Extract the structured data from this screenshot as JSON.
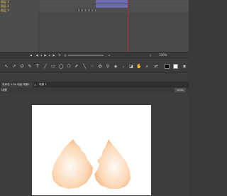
{
  "timeline": {
    "layers": [
      {
        "name": "图层 1",
        "color": "#e9c25a"
      },
      {
        "name": "图层 2",
        "color": "#e9c25a"
      },
      {
        "name": "图层 3",
        "color": "#e9c25a"
      }
    ]
  },
  "transport": {
    "zoom": "100%"
  },
  "tabs": {
    "document_tab": "未命名-1.fla 动画 场景1",
    "second_tab": "场景 1",
    "close_glyph": "×"
  },
  "subbar": {
    "scene_label": "场景",
    "right_label": "100%"
  },
  "colors": {
    "playhead": "#b03030",
    "frame_span": "#6c6cae",
    "eggshell_fill": "#f6b886"
  },
  "icons": [
    "selection-icon",
    "subselection-icon",
    "lasso-icon",
    "pen-icon",
    "text-icon",
    "line-icon",
    "rectangle-icon",
    "oval-icon",
    "polystar-icon",
    "pencil-icon",
    "brush-icon",
    "spray-icon",
    "deco-icon",
    "bone-icon",
    "paint-bucket-icon",
    "eyedropper-icon",
    "eraser-icon",
    "hand-icon",
    "zoom-icon",
    "stroke-color-icon",
    "fill-color-icon"
  ]
}
